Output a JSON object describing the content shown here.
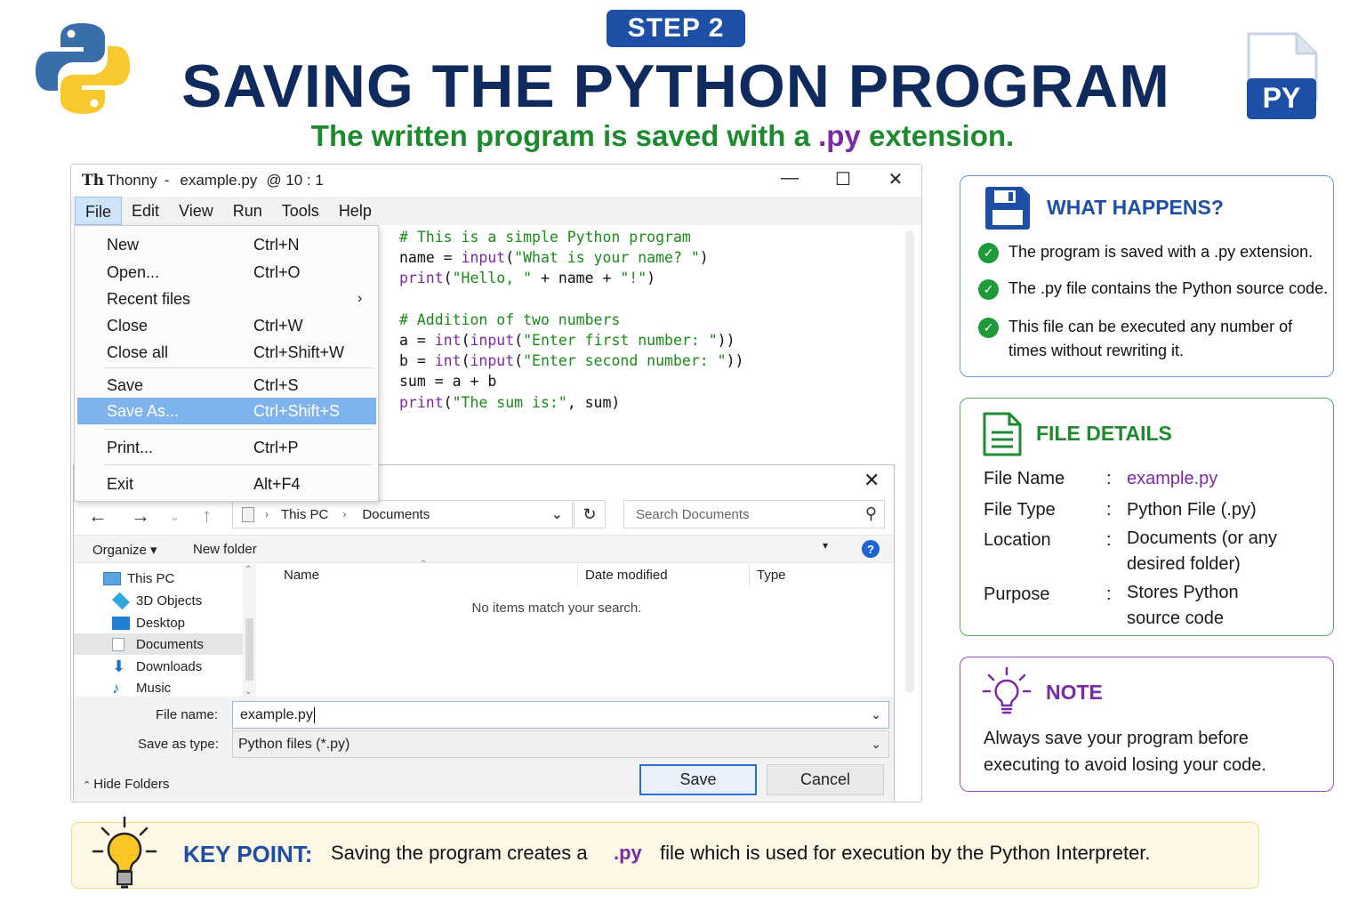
{
  "header": {
    "step": "STEP 2",
    "title": "SAVING THE PYTHON PROGRAM",
    "subtitle_pre": "The written program is saved with a ",
    "subtitle_ext": ".py",
    "subtitle_post": " extension.",
    "file_badge": "PY"
  },
  "thonny": {
    "app": "Thonny",
    "sep": "-",
    "file": "example.py",
    "position": "@ 10 : 1",
    "window_controls": {
      "minimize": "—",
      "maximize": "☐",
      "close": "✕"
    },
    "menu": [
      "File",
      "Edit",
      "View",
      "Run",
      "Tools",
      "Help"
    ],
    "code": [
      "# This is a simple Python program",
      "name = input(\"What is your name? \")",
      "print(\"Hello, \" + name + \"!\")",
      "",
      "# Addition of two numbers",
      "a = int(input(\"Enter first number: \"))",
      "b = int(input(\"Enter second number: \"))",
      "sum = a + b",
      "print(\"The sum is:\", sum)"
    ]
  },
  "file_menu": {
    "items": [
      {
        "label": "New",
        "shortcut": "Ctrl+N"
      },
      {
        "label": "Open...",
        "shortcut": "Ctrl+O"
      },
      {
        "label": "Recent files",
        "shortcut": "",
        "arrow": "›"
      },
      {
        "label": "Close",
        "shortcut": "Ctrl+W"
      },
      {
        "label": "Close all",
        "shortcut": "Ctrl+Shift+W"
      },
      {
        "label": "Save",
        "shortcut": "Ctrl+S"
      },
      {
        "label": "Save As...",
        "shortcut": "Ctrl+Shift+S",
        "highlighted": true
      },
      {
        "label": "Print...",
        "shortcut": "Ctrl+P"
      },
      {
        "label": "Exit",
        "shortcut": "Alt+F4"
      }
    ]
  },
  "save_dialog": {
    "path": [
      "This PC",
      "Documents"
    ],
    "search_placeholder": "Search Documents",
    "toolbar": {
      "organize": "Organize ▾",
      "new_folder": "New folder"
    },
    "tree": [
      "This PC",
      "3D Objects",
      "Desktop",
      "Documents",
      "Downloads",
      "Music"
    ],
    "selected_tree_item": "Documents",
    "columns": [
      "Name",
      "Date modified",
      "Type"
    ],
    "empty_message": "No items match your search.",
    "file_name_label": "File name:",
    "file_name_value": "example.py",
    "save_type_label": "Save as type:",
    "save_type_value": "Python files (*.py)",
    "hide_folders": "Hide Folders",
    "save_button": "Save",
    "cancel_button": "Cancel"
  },
  "what_happens": {
    "title": "WHAT HAPPENS?",
    "items": [
      "The program is saved with a .py extension.",
      "The .py file contains the Python source code.",
      "This file can be executed any number of times without rewriting it."
    ]
  },
  "file_details": {
    "title": "FILE DETAILS",
    "rows": [
      {
        "label": "File Name",
        "value": "example.py"
      },
      {
        "label": "File Type",
        "value": "Python File (.py)"
      },
      {
        "label": "Location",
        "value": "Documents (or any desired folder)"
      },
      {
        "label": "Purpose",
        "value": "Stores Python source code"
      }
    ],
    "colon": ":"
  },
  "note": {
    "title": "NOTE",
    "text": "Always save your program before executing to avoid losing your code."
  },
  "key_point": {
    "label": "KEY POINT:",
    "pre": "Saving the program creates a",
    "ext": ".py",
    "post": "file which is used for execution by the Python Interpreter."
  },
  "colors": {
    "navy": "#0f2a5c",
    "blue": "#1d4fa6",
    "green": "#1d8a2e",
    "purple": "#7b2aa6",
    "highlight": "#7fb3ee"
  },
  "icons": [
    "python-logo",
    "py-file-icon",
    "floppy-disk-icon",
    "document-icon",
    "lightbulb-icon",
    "check-icon"
  ]
}
